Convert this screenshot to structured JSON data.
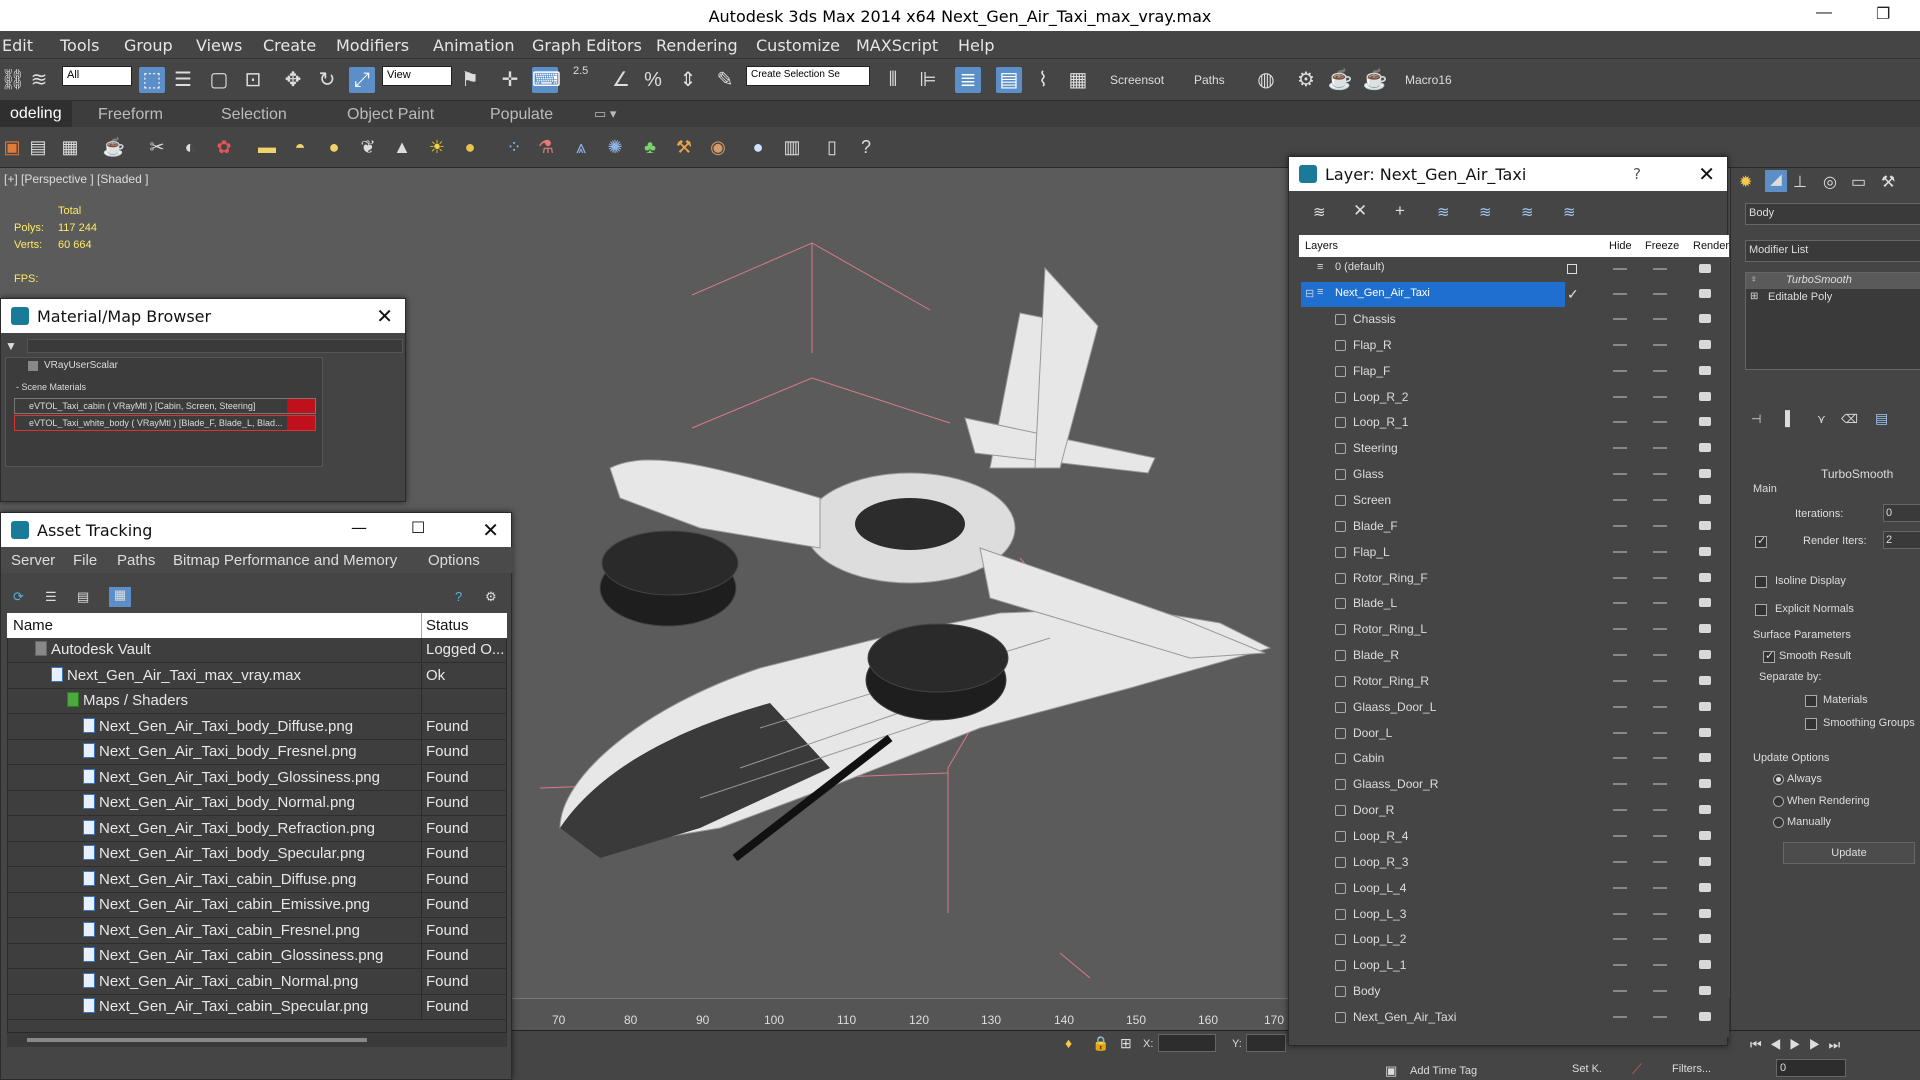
{
  "window": {
    "title": "Autodesk 3ds Max  2014 x64      Next_Gen_Air_Taxi_max_vray.max"
  },
  "menu": [
    "Edit",
    "Tools",
    "Group",
    "Views",
    "Create",
    "Modifiers",
    "Animation",
    "Graph Editors",
    "Rendering",
    "Customize",
    "MAXScript",
    "Help"
  ],
  "toolbar1": {
    "filter": "All",
    "refcoord": "View",
    "selset": "Create Selection Se",
    "screenshot": "Screensot",
    "paths": "Paths",
    "macro": "Macro16",
    "snap": "2.5"
  },
  "ribbon_tabs": [
    "odeling",
    "Freeform",
    "Selection",
    "Object Paint",
    "Populate"
  ],
  "viewport": {
    "label": "[+] [Perspective ] [Shaded ]",
    "total_label": "Total",
    "polys_label": "Polys:",
    "polys": "117 244",
    "verts_label": "Verts:",
    "verts": "60 664",
    "fps_label": "FPS:"
  },
  "timeline_ticks": [
    "70",
    "80",
    "90",
    "100",
    "110",
    "120",
    "130",
    "140",
    "150",
    "160",
    "170"
  ],
  "status": {
    "add_time_tag": "Add Time Tag",
    "setk": "Set K.",
    "filters": "Filters...",
    "x_label": "X:",
    "y_label": "Y:",
    "frame": "0"
  },
  "material_browser": {
    "title": "Material/Map Browser",
    "item_scalar": "VRayUserScalar",
    "section": "- Scene Materials",
    "materials": [
      "eVTOL_Taxi_cabin ( VRayMtl ) [Cabin, Screen, Steering]",
      "eVTOL_Taxi_white_body ( VRayMtl ) [Blade_F, Blade_L, Blad..."
    ]
  },
  "asset_tracking": {
    "title": "Asset Tracking",
    "menu": [
      "Server",
      "File",
      "Paths",
      "Bitmap Performance and Memory",
      "Options"
    ],
    "col_name": "Name",
    "col_status": "Status",
    "rows": [
      {
        "name": "Autodesk Vault",
        "status": "Logged O...",
        "indent": 1
      },
      {
        "name": "Next_Gen_Air_Taxi_max_vray.max",
        "status": "Ok",
        "indent": 2
      },
      {
        "name": "Maps / Shaders",
        "status": "",
        "indent": 3
      },
      {
        "name": "Next_Gen_Air_Taxi_body_Diffuse.png",
        "status": "Found",
        "indent": 4
      },
      {
        "name": "Next_Gen_Air_Taxi_body_Fresnel.png",
        "status": "Found",
        "indent": 4
      },
      {
        "name": "Next_Gen_Air_Taxi_body_Glossiness.png",
        "status": "Found",
        "indent": 4
      },
      {
        "name": "Next_Gen_Air_Taxi_body_Normal.png",
        "status": "Found",
        "indent": 4
      },
      {
        "name": "Next_Gen_Air_Taxi_body_Refraction.png",
        "status": "Found",
        "indent": 4
      },
      {
        "name": "Next_Gen_Air_Taxi_body_Specular.png",
        "status": "Found",
        "indent": 4
      },
      {
        "name": "Next_Gen_Air_Taxi_cabin_Diffuse.png",
        "status": "Found",
        "indent": 4
      },
      {
        "name": "Next_Gen_Air_Taxi_cabin_Emissive.png",
        "status": "Found",
        "indent": 4
      },
      {
        "name": "Next_Gen_Air_Taxi_cabin_Fresnel.png",
        "status": "Found",
        "indent": 4
      },
      {
        "name": "Next_Gen_Air_Taxi_cabin_Glossiness.png",
        "status": "Found",
        "indent": 4
      },
      {
        "name": "Next_Gen_Air_Taxi_cabin_Normal.png",
        "status": "Found",
        "indent": 4
      },
      {
        "name": "Next_Gen_Air_Taxi_cabin_Specular.png",
        "status": "Found",
        "indent": 4
      }
    ]
  },
  "layer_panel": {
    "title": "Layer: Next_Gen_Air_Taxi",
    "help": "?",
    "col_layers": "Layers",
    "col_hide": "Hide",
    "col_freeze": "Freeze",
    "col_render": "Render",
    "default_layer": "0 (default)",
    "active_layer": "Next_Gen_Air_Taxi",
    "objects": [
      "Chassis",
      "Flap_R",
      "Flap_F",
      "Loop_R_2",
      "Loop_R_1",
      "Steering",
      "Glass",
      "Screen",
      "Blade_F",
      "Flap_L",
      "Rotor_Ring_F",
      "Blade_L",
      "Rotor_Ring_L",
      "Blade_R",
      "Rotor_Ring_R",
      "Glaass_Door_L",
      "Door_L",
      "Cabin",
      "Glaass_Door_R",
      "Door_R",
      "Loop_R_4",
      "Loop_R_3",
      "Loop_L_4",
      "Loop_L_3",
      "Loop_L_2",
      "Loop_L_1",
      "Body",
      "Next_Gen_Air_Taxi"
    ]
  },
  "command_panel": {
    "object_name": "Body",
    "modifier_list": "Modifier List",
    "stack": [
      "TurboSmooth",
      "Editable Poly"
    ],
    "rollout": "TurboSmooth",
    "main": "Main",
    "iterations_label": "Iterations:",
    "iterations": "0",
    "render_iters_label": "Render Iters:",
    "render_iters": "2",
    "isoline": "Isoline Display",
    "explicit": "Explicit Normals",
    "surface": "Surface Parameters",
    "smooth_result": "Smooth Result",
    "separate_by": "Separate by:",
    "materials": "Materials",
    "smoothing_groups": "Smoothing Groups",
    "update_options": "Update Options",
    "always": "Always",
    "when_rendering": "When Rendering",
    "manually": "Manually",
    "update": "Update"
  }
}
